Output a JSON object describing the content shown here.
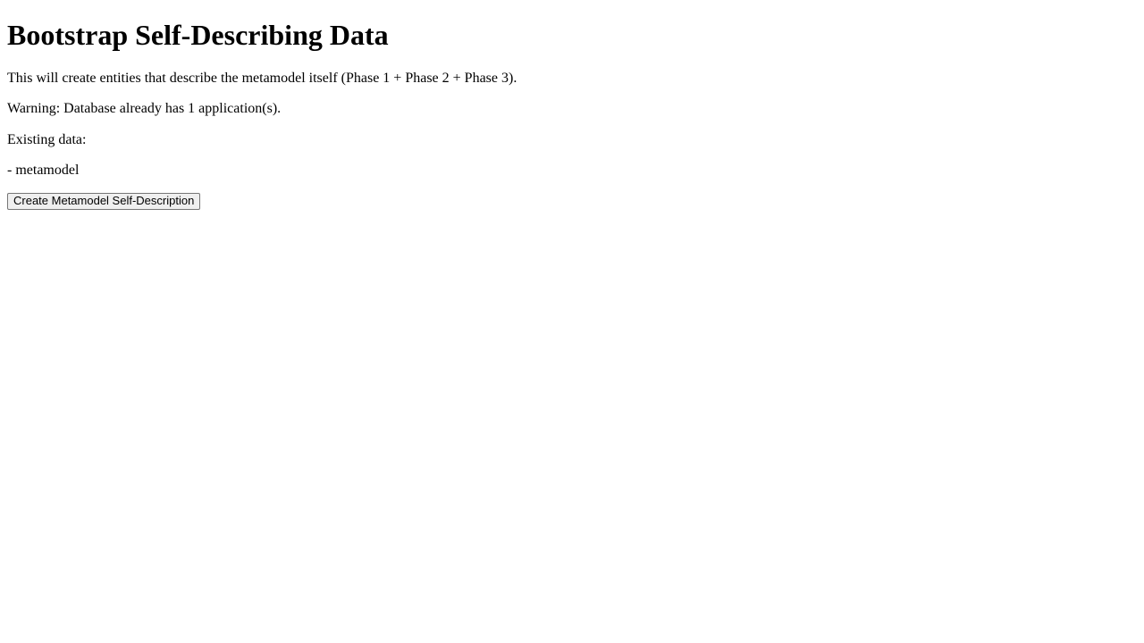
{
  "page": {
    "title": "Bootstrap Self-Describing Data",
    "description": "This will create entities that describe the metamodel itself (Phase 1 + Phase 2 + Phase 3).",
    "warning": "Warning: Database already has 1 application(s).",
    "existing_label": "Existing data:",
    "existing_items": [
      "- metamodel"
    ]
  },
  "actions": {
    "create_label": "Create Metamodel Self-Description"
  }
}
